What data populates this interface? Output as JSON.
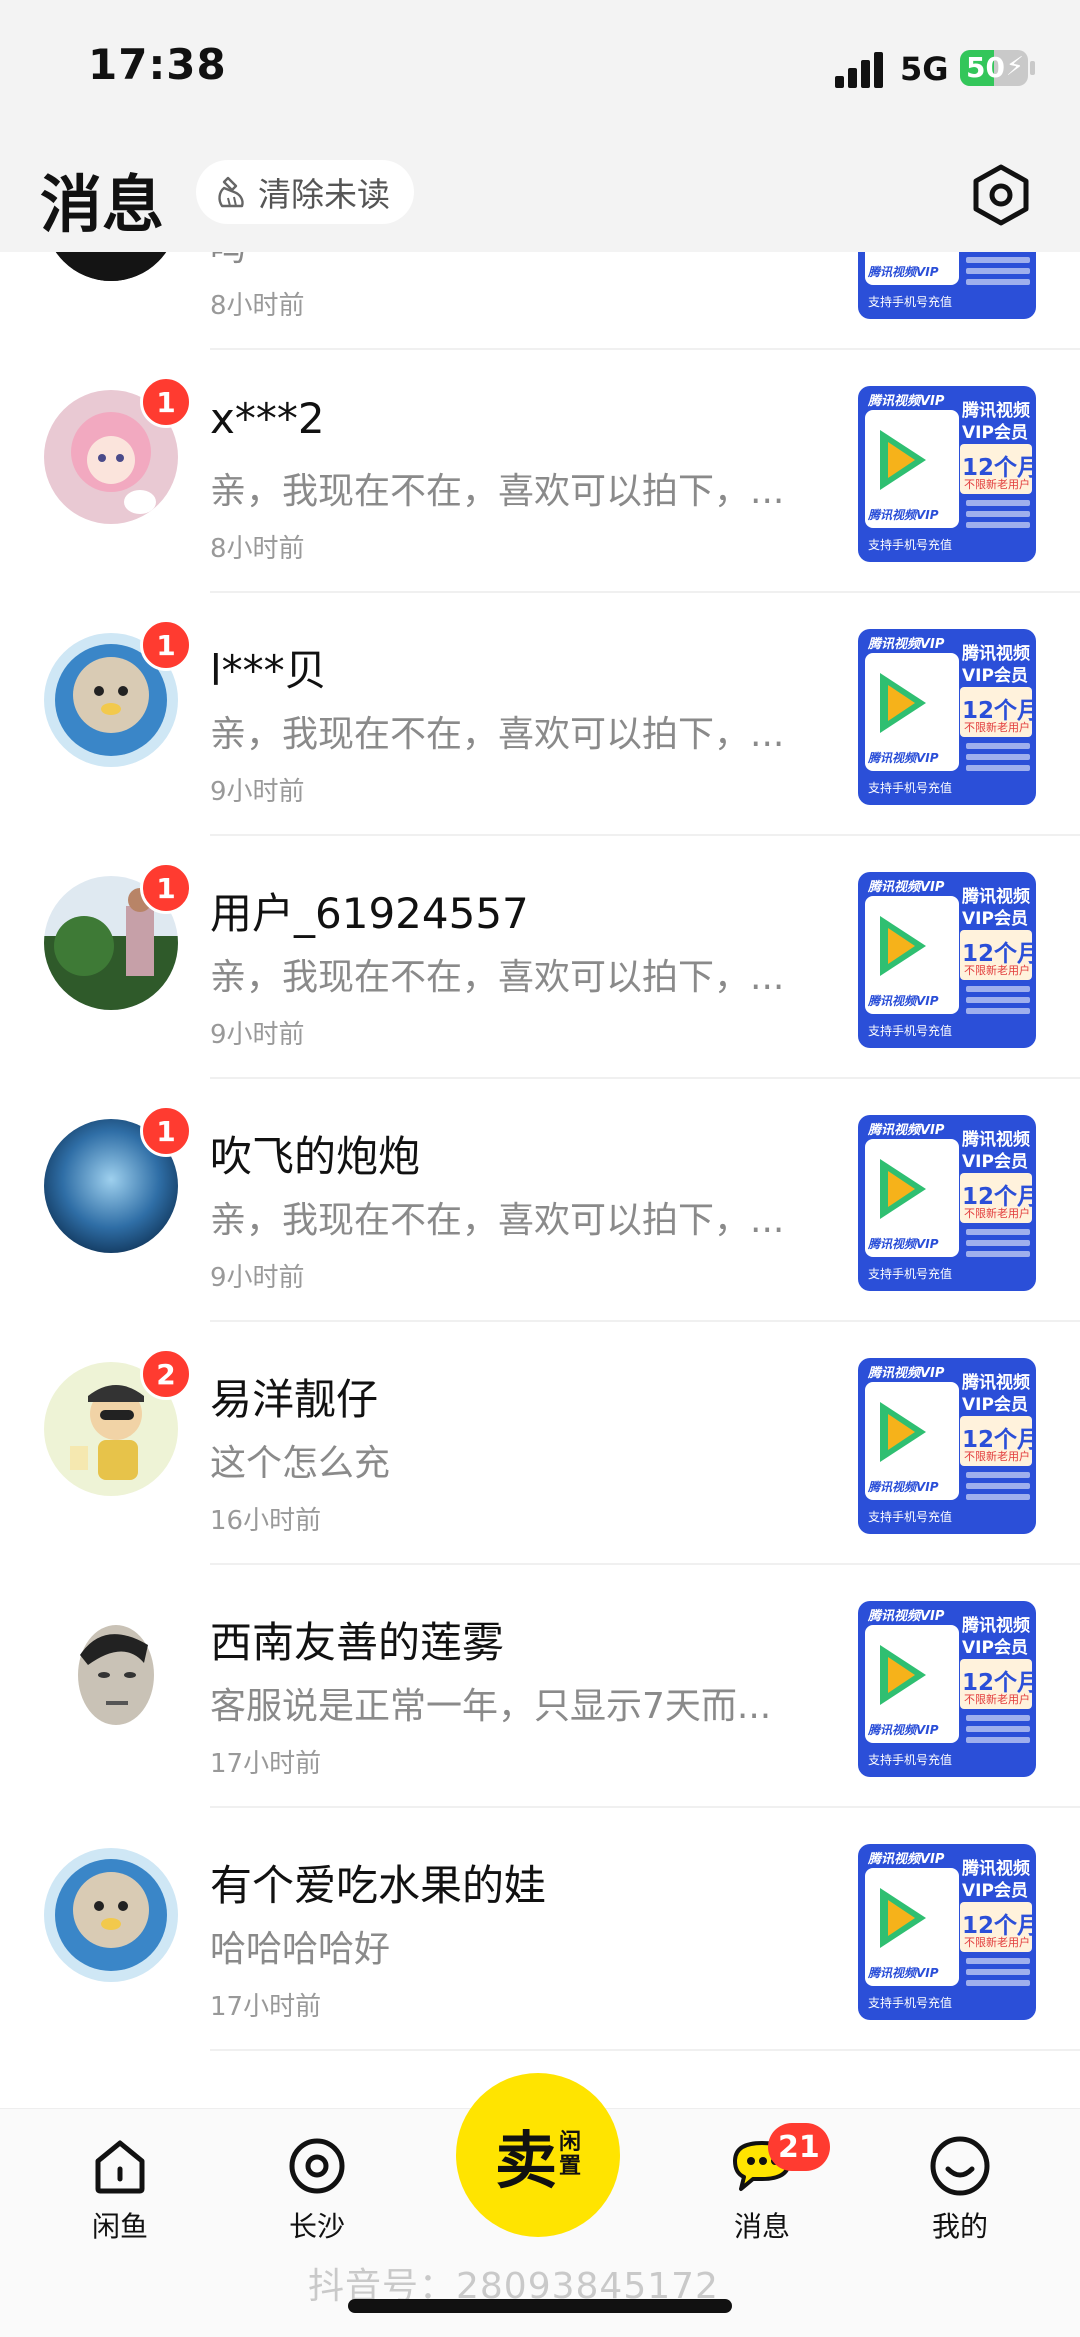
{
  "status_bar": {
    "time": "17:38",
    "network": "5G",
    "battery_level": "50",
    "battery_fraction": 0.5
  },
  "header": {
    "title": "消息",
    "clear_unread_label": "清除未读",
    "settings_icon": "settings-hexagon-icon"
  },
  "thumbnail": {
    "brand": "腾讯视频VIP",
    "title_line1": "腾讯视频",
    "title_line2": "VIP会员",
    "duration": "12个月",
    "note": "不限新老用户",
    "logo_text": "腾讯视频VIP",
    "footer": "支持手机号充值",
    "colors": {
      "background": "#2b4fd8",
      "play": "#2fbf71",
      "accent": "#f6b21a"
    }
  },
  "conversations": [
    {
      "name": "",
      "preview": "吗",
      "time": "8小时前",
      "badge": ""
    },
    {
      "name": "x***2",
      "preview": "亲，我现在不在，喜欢可以拍下，...",
      "time": "8小时前",
      "badge": "1"
    },
    {
      "name": "l***贝",
      "preview": "亲，我现在不在，喜欢可以拍下，...",
      "time": "9小时前",
      "badge": "1"
    },
    {
      "name": "用户_61924557",
      "preview": "亲，我现在不在，喜欢可以拍下，...",
      "time": "9小时前",
      "badge": "1"
    },
    {
      "name": "吹飞的炮炮",
      "preview": "亲，我现在不在，喜欢可以拍下，...",
      "time": "9小时前",
      "badge": "1"
    },
    {
      "name": "易洋靓仔",
      "preview": "这个怎么充",
      "time": "16小时前",
      "badge": "2"
    },
    {
      "name": "西南友善的莲雾",
      "preview": "客服说是正常一年，只显示7天而...",
      "time": "17小时前",
      "badge": ""
    },
    {
      "name": "有个爱吃水果的娃",
      "preview": "哈哈哈哈好",
      "time": "17小时前",
      "badge": ""
    }
  ],
  "bottom_nav": {
    "items": [
      {
        "label": "闲鱼",
        "icon": "home-icon"
      },
      {
        "label": "长沙",
        "icon": "location-icon"
      },
      {
        "label": "消息",
        "icon": "message-bubble-icon",
        "badge": "21"
      },
      {
        "label": "我的",
        "icon": "profile-smile-icon"
      }
    ],
    "sell": {
      "main": "卖",
      "sub1": "闲",
      "sub2": "置"
    },
    "accent_color": "#ffe400"
  },
  "watermark": "抖音号：28093845172"
}
